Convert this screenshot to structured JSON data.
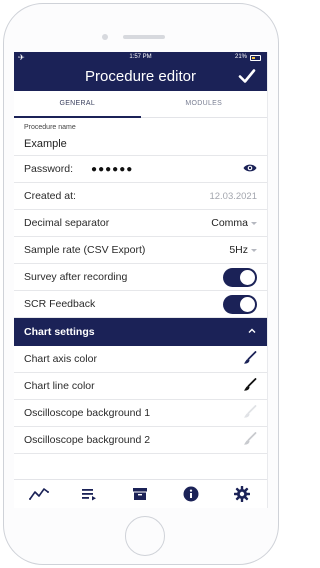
{
  "status": {
    "time": "1:57 PM",
    "battery": "21%"
  },
  "header": {
    "title": "Procedure editor"
  },
  "tabs": [
    {
      "label": "GENERAL"
    },
    {
      "label": "MODULES"
    }
  ],
  "procedure_name": {
    "label": "Procedure name",
    "value": "Example"
  },
  "password": {
    "label": "Password:",
    "masked": "●●●●●●"
  },
  "created": {
    "label": "Created at:",
    "value": "12.03.2021"
  },
  "decimal": {
    "label": "Decimal separator",
    "value": "Comma"
  },
  "sample_rate": {
    "label": "Sample rate (CSV Export)",
    "value": "5Hz"
  },
  "survey": {
    "label": "Survey after recording",
    "on": true
  },
  "scr": {
    "label": "SCR Feedback",
    "on": true
  },
  "chart_section": {
    "label": "Chart settings"
  },
  "chart_items": [
    {
      "label": "Chart axis color",
      "color": "#1b2257"
    },
    {
      "label": "Chart line color",
      "color": "#111111"
    },
    {
      "label": "Oscilloscope background 1",
      "color": "#d7d9de"
    },
    {
      "label": "Oscilloscope background 2",
      "color": "#c4c6cc"
    }
  ],
  "bottom_nav": [
    {
      "icon": "chart-line-icon"
    },
    {
      "icon": "playlist-icon"
    },
    {
      "icon": "archive-icon"
    },
    {
      "icon": "info-icon"
    },
    {
      "icon": "gear-icon"
    }
  ],
  "colors": {
    "primary": "#1b2257",
    "muted_text": "#a3a6ae"
  }
}
